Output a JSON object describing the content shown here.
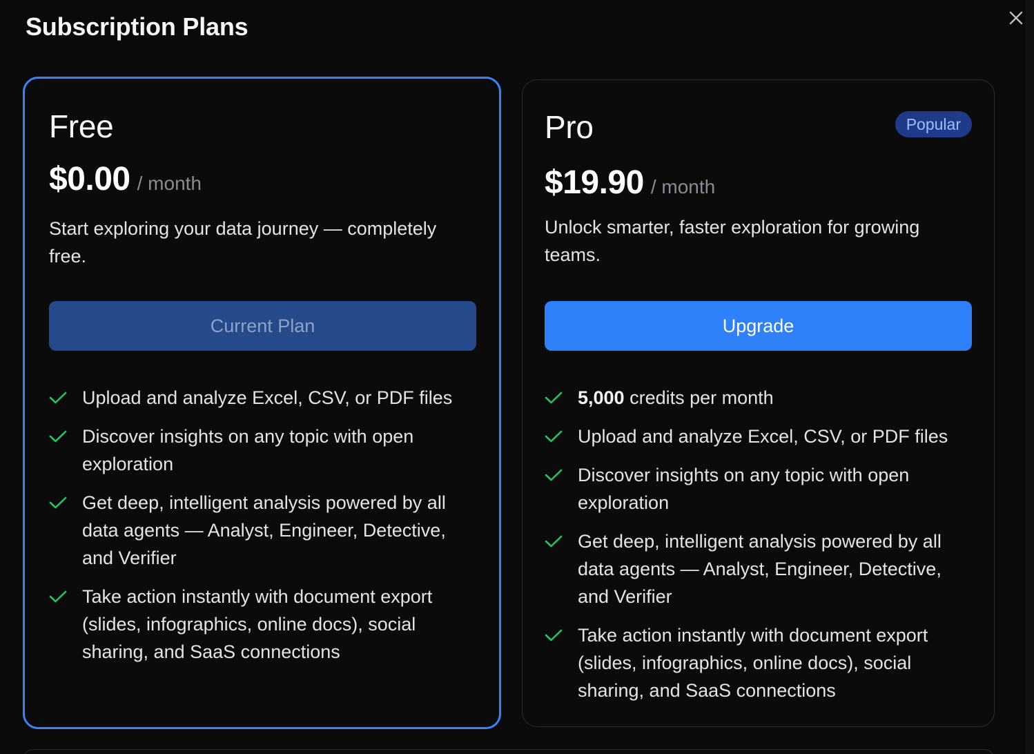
{
  "modal": {
    "title": "Subscription Plans",
    "close_icon": "close-icon"
  },
  "plans": [
    {
      "name": "Free",
      "price": "$0.00",
      "period": "/ month",
      "description": "Start exploring your data journey — completely free.",
      "button_label": "Current Plan",
      "current": true,
      "features": [
        "Upload and analyze Excel, CSV, or PDF files",
        "Discover insights on any topic with open exploration",
        "Get deep, intelligent analysis powered by all data agents — Analyst, Engineer, Detective, and Verifier",
        "Take action instantly with document export (slides, infographics, online docs), social sharing, and SaaS connections"
      ]
    },
    {
      "name": "Pro",
      "badge": "Popular",
      "price": "$19.90",
      "period": "/ month",
      "description": "Unlock smarter, faster exploration for growing teams.",
      "button_label": "Upgrade",
      "current": false,
      "credits_amount": "5,000",
      "credits_text": " credits per month",
      "features": [
        "Upload and analyze Excel, CSV, or PDF files",
        "Discover insights on any topic with open exploration",
        "Get deep, intelligent analysis powered by all data agents — Analyst, Engineer, Detective, and Verifier",
        "Take action instantly with document export (slides, infographics, online docs), social sharing, and SaaS connections"
      ]
    }
  ],
  "colors": {
    "accent": "#3b82f6",
    "upgrade_button": "#2f80fb",
    "current_button": "#254a8c",
    "check": "#22c55e",
    "badge_bg": "#1f3a8a",
    "badge_text": "#9cc0ff"
  },
  "icons": {
    "feature_check": "check-icon"
  }
}
